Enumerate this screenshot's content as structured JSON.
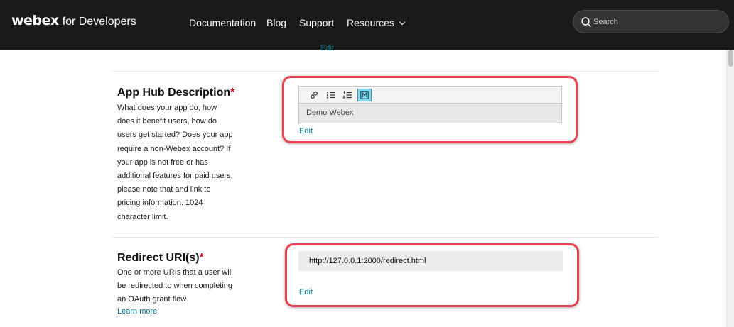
{
  "header": {
    "logo_text": "webex",
    "logo_sub": "for Developers",
    "nav": {
      "documentation": "Documentation",
      "blog": "Blog",
      "support": "Support",
      "resources": "Resources"
    },
    "search_placeholder": "Search"
  },
  "top_cut_link": "Edit",
  "app_hub": {
    "title": "App Hub Description",
    "required_mark": "*",
    "desc_lines": [
      "What does your app do, how",
      "does it benefit users, how do",
      "users get started? Does your app",
      "require a non-Webex account? If",
      "your app is not free or has",
      "additional features for paid users,",
      "please note that and link to",
      "pricing information. 1024",
      "character limit."
    ],
    "toolbar_icons": [
      "link-icon",
      "bullet-list-icon",
      "numbered-list-icon",
      "markdown-icon"
    ],
    "editor_value": "Demo Webex",
    "edit_label": "Edit",
    "highlight_color": "#e8414f"
  },
  "redirect": {
    "title": "Redirect URI(s)",
    "required_mark": "*",
    "desc_lines": [
      "One or more URIs that a user will",
      "be redirected to when completing",
      "an OAuth grant flow."
    ],
    "learn_more": "Learn more",
    "uri_value": "http://127.0.0.1:2000/redirect.html",
    "edit_label": "Edit"
  },
  "colors": {
    "header_bg": "#1a1a1a",
    "link": "#00758f",
    "required": "#d2001f",
    "highlight": "#e8414f",
    "active_tool": "#7fdbe8"
  }
}
